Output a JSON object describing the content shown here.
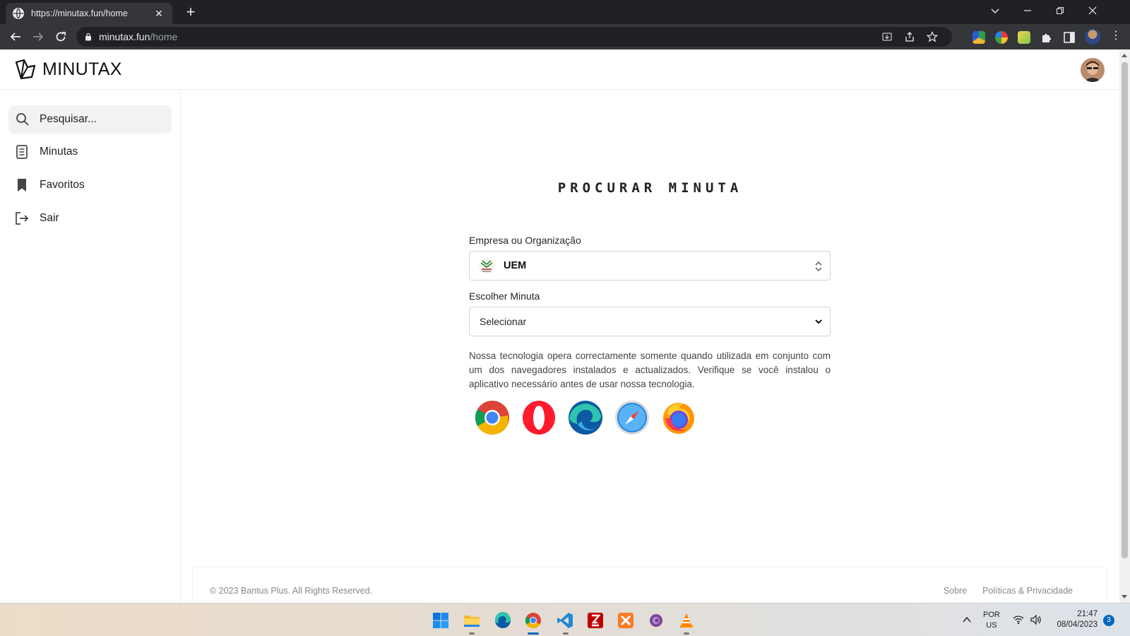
{
  "browser": {
    "tab_title": "https://minutax.fun/home",
    "tab_close": "✕",
    "new_tab": "+",
    "url_host": "minutax.fun",
    "url_path": "/home",
    "menu_glyph": "⋮"
  },
  "app": {
    "brand": "MINUTAX",
    "sidebar": {
      "search_placeholder": "Pesquisar...",
      "items": [
        {
          "label": "Minutas",
          "icon": "document-icon"
        },
        {
          "label": "Favoritos",
          "icon": "bookmark-icon"
        },
        {
          "label": "Sair",
          "icon": "logout-icon"
        }
      ]
    },
    "main": {
      "title": "PROCURAR MINUTA",
      "org_label": "Empresa ou Organização",
      "org_value": "UEM",
      "minuta_label": "Escolher Minuta",
      "minuta_value": "Selecionar",
      "notice": "Nossa tecnologia opera correctamente somente quando utilizada em conjunto com um dos navegadores instalados e actualizados. Verifique se você instalou o aplicativo necessário antes de usar nossa tecnologia.",
      "browsers": [
        "chrome-icon",
        "opera-icon",
        "edge-icon",
        "safari-icon",
        "firefox-icon"
      ]
    },
    "footer": {
      "copyright": "© 2023 Bantus Plus. All Rights Reserved.",
      "links": [
        "Sobre",
        "Políticas & Privacidade"
      ]
    }
  },
  "taskbar": {
    "lang_line1": "POR",
    "lang_line2": "US",
    "time": "21:47",
    "date": "08/04/2023",
    "notifications": "3"
  },
  "colors": {
    "chrome_dark": "#202124",
    "chrome_toolbar": "#35363a",
    "accent": "#0067c0"
  }
}
